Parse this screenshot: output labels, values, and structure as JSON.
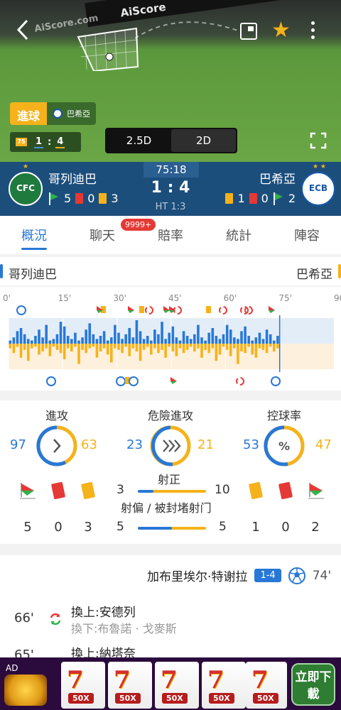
{
  "pitch": {
    "banner_text": "AiScore",
    "watermark": "AiScore.com",
    "event_label": "進球",
    "event_team": "巴希亞",
    "mini_score_home": "1",
    "mini_score_away": "4",
    "mode_25d": "2.5D",
    "mode_2d": "2D",
    "mode_active": "2.5D"
  },
  "header": {
    "home": {
      "name": "哥列迪巴",
      "logo_text": "CFC",
      "corners": "5",
      "red": "0",
      "yellow": "3"
    },
    "away": {
      "name": "巴希亞",
      "logo_text": "ECB",
      "corners": "2",
      "red": "0",
      "yellow": "1"
    },
    "clock": "75:18",
    "score": "1 : 4",
    "half_time": "HT 1:3"
  },
  "tabs": [
    {
      "label": "概況",
      "active": true
    },
    {
      "label": "聊天",
      "badge": "9999+"
    },
    {
      "label": "賠率"
    },
    {
      "label": "統計"
    },
    {
      "label": "陣容"
    }
  ],
  "timeline": {
    "home_team": "哥列迪巴",
    "away_team": "巴希亞",
    "ticks": [
      "0'",
      "15'",
      "30'",
      "45'",
      "60'",
      "75'",
      "90"
    ],
    "current_minute": 75,
    "home_pressure": [
      2,
      4,
      8,
      10,
      6,
      3,
      2,
      5,
      9,
      4,
      12,
      2,
      3,
      6,
      14,
      11,
      5,
      3,
      7,
      2,
      4,
      9,
      13,
      6,
      3,
      5,
      8,
      2,
      4,
      12,
      7,
      3,
      6,
      10,
      4,
      15,
      8,
      3,
      5,
      2,
      9,
      6,
      14,
      3,
      7,
      11,
      4,
      2,
      8,
      5,
      3,
      6,
      12,
      4,
      2,
      7,
      10,
      5,
      3,
      6,
      12,
      9,
      4,
      3,
      8,
      11,
      5,
      2,
      4,
      7,
      3,
      9,
      6,
      2,
      5
    ],
    "away_pressure": [
      3,
      6,
      2,
      9,
      4,
      11,
      3,
      2,
      7,
      5,
      3,
      8,
      2,
      4,
      6,
      10,
      3,
      5,
      2,
      13,
      4,
      6,
      3,
      2,
      9,
      5,
      3,
      7,
      12,
      3,
      4,
      6,
      2,
      8,
      3,
      5,
      11,
      4,
      2,
      7,
      3,
      6,
      4,
      9,
      2,
      5,
      8,
      3,
      6,
      4,
      2,
      5,
      3,
      9,
      4,
      6,
      3,
      11,
      7,
      2,
      4,
      8,
      3,
      13,
      5,
      6,
      2,
      7,
      9,
      3,
      4,
      6,
      2,
      5,
      3
    ]
  },
  "stats": {
    "attack": {
      "label": "進攻",
      "home": "97",
      "away": "63",
      "icon": "chevron-right-icon"
    },
    "dangerous": {
      "label": "危險進攻",
      "home": "23",
      "away": "21",
      "icon": "double-chevron-icon"
    },
    "possession": {
      "label": "控球率",
      "home": "53",
      "away": "47",
      "icon": "percent-icon"
    },
    "shots_on": {
      "label": "射正",
      "home": "3",
      "away": "10"
    },
    "shots_off": {
      "label": "射偏 / 被封堵射门",
      "home": "5",
      "away": "5"
    },
    "home_counts": {
      "corners": "5",
      "red": "0",
      "yellow": "3"
    },
    "away_counts": {
      "yellow": "1",
      "red": "0",
      "corners": "2"
    }
  },
  "events": {
    "goal": {
      "player": "加布里埃尔·特谢拉",
      "score": "1-4",
      "minute": "74'"
    },
    "subs": [
      {
        "minute": "66'",
        "in": "換上:安德列",
        "out": "換下:布魯諾 · 戈麥斯"
      },
      {
        "minute": "65'",
        "in": "換上:納塔奈",
        "out": ""
      }
    ]
  },
  "ad": {
    "label": "AD",
    "logo_text": "豪神",
    "reel_badge": "50X",
    "cta": "立即下載"
  },
  "colors": {
    "home": "#2878d6",
    "away": "#f5b21b",
    "header_bg": "#1c4e7c"
  }
}
